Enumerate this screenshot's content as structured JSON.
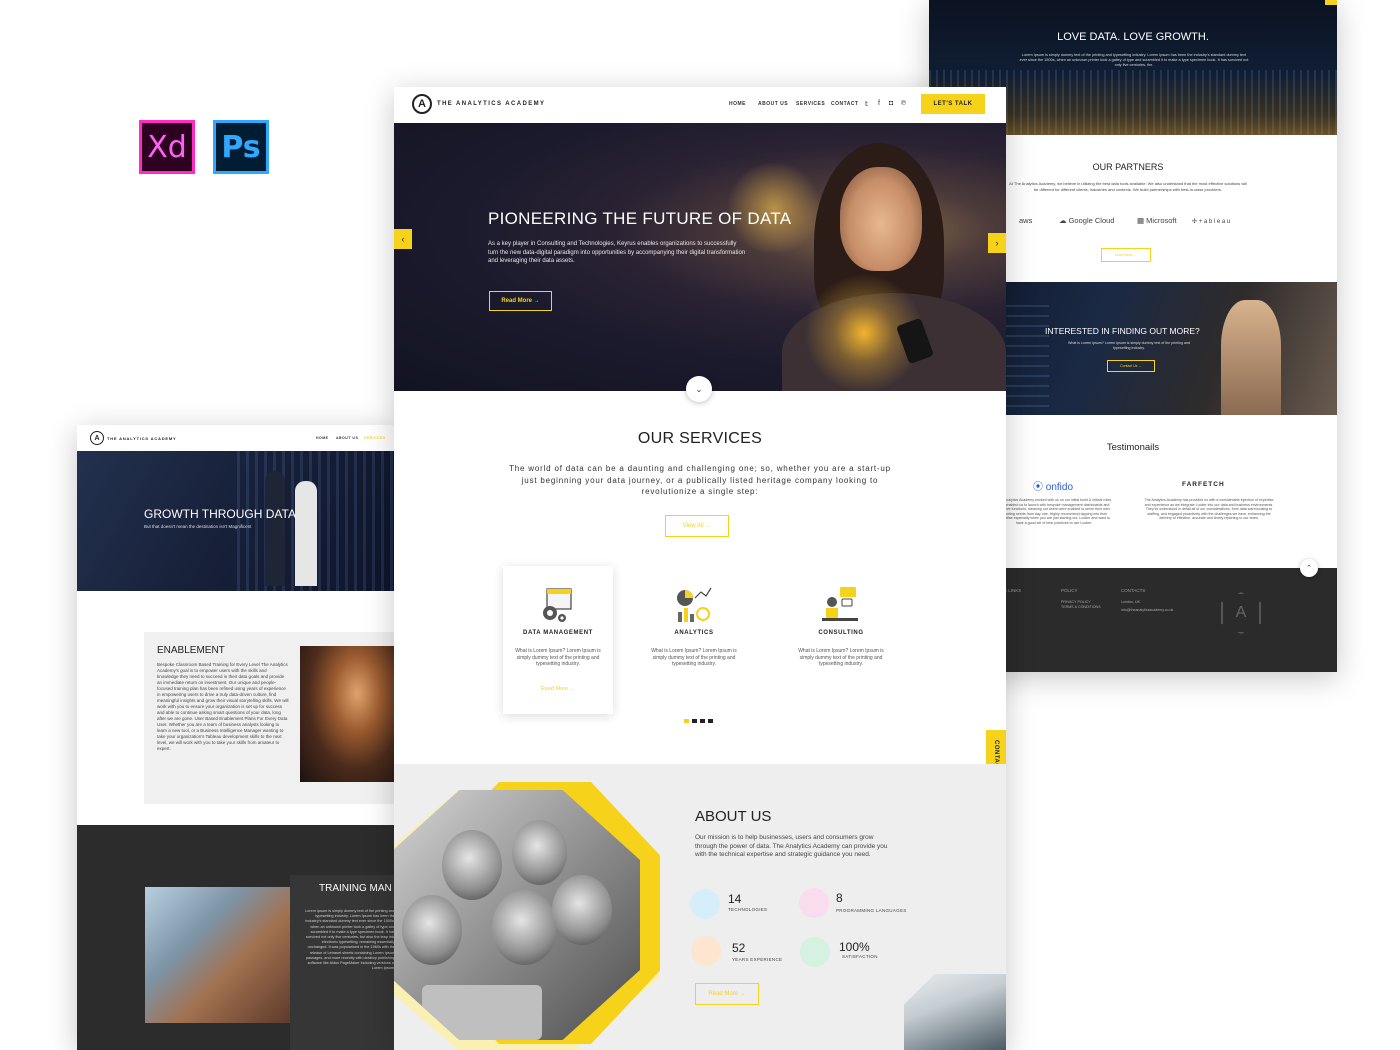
{
  "badges": {
    "xd": "Xd",
    "ps": "Ps"
  },
  "main": {
    "logo_letter": "A",
    "logo_text": "The Analytics Academy",
    "nav": [
      "HOME",
      "ABOUT US",
      "SERVICES",
      "CONTACT"
    ],
    "social_icons": [
      "twitter-icon",
      "facebook-icon",
      "instagram-icon",
      "pinterest-icon"
    ],
    "cta": "LET'S TALK",
    "hero": {
      "title": "PIONEERING THE FUTURE OF DATA",
      "text": "As a key player in Consulting and Technologies, Keyrus enables organizations to successfully turn the new data-digital paradigm into opportunities by accompanying their digital transformation and leveraging their data assets.",
      "button": "Read More →",
      "prev": "‹",
      "next": "›",
      "down": "⌄"
    },
    "services": {
      "title": "OUR SERVICES",
      "text": "The world of data can be a daunting and challenging one; so, whether you are a start-up just beginning your data journey, or a publically listed heritage company looking to revolutionize a single step:",
      "button": "View All →",
      "items": [
        {
          "title": "DATA MANAGEMENT",
          "desc": "What is Lorem Ipsum? Lorem Ipsum is simply dummy text of the printing and typesetting industry.",
          "more": "Read More →"
        },
        {
          "title": "ANALYTICS",
          "desc": "What is Lorem Ipsum? Lorem Ipsum is simply dummy text of the printing and typesetting industry."
        },
        {
          "title": "CONSULTING",
          "desc": "What is Lorem Ipsum? Lorem Ipsum is simply dummy text of the printing and typesetting industry."
        }
      ]
    },
    "contact_tab": "CONTACT US",
    "about": {
      "title": "ABOUT US",
      "text": "Our mission is to help businesses, users and consumers grow through the power of data. The Analytics Academy can provide you with the technical expertise and strategic guidance you need.",
      "stats": [
        {
          "value": "14",
          "label": "TECHNOLOGIES",
          "color": "#5bb6e6"
        },
        {
          "value": "8",
          "label": "PROGRAMMING LANGUAGES",
          "color": "#e86bb8"
        },
        {
          "value": "52",
          "label": "YEARS EXPERIENCE",
          "color": "#f29a4a"
        },
        {
          "value": "100%",
          "label": "SATISFACTION",
          "color": "#4fbf84"
        }
      ],
      "button": "Read More →"
    }
  },
  "left": {
    "logo_text": "The Analytics Academy",
    "nav": [
      "HOME",
      "ABOUT US",
      "SERVICES"
    ],
    "hero_title": "GROWTH THROUGH DATA",
    "hero_text": "But that doesn't mean the destination isn't Magnificent",
    "enablement_title": "ENABLEMENT",
    "enablement_text": "Bespoke Classroom Based Training for Every Level The Analytics Academy's goal is to empower users with the skills and knowledge they need to succeed in their data goals and provide an immediate return on investment. Our unique and people-focused training plan has been refined using years of experience in empowering users to drive a truly data-driven culture, find meaningful insights and grow their visual storytelling skills. We will work with you to ensure your organization is set up for success and able to continue asking smart questions of your data, long after we are gone. User Based Enablement Plans For Every Data User. Whether you are a team of business analysts looking to learn a new tool, or a Business Intelligence Manager wanting to take your organization's Tableau development skills to the next level, we will work with you to take your skills from amateur to expert.",
    "training_title": "TRAINING MAN",
    "training_text": "Lorem Ipsum is simply dummy text of the printing and typesetting industry. Lorem Ipsum has been the industry's standard dummy text ever since the 1500s, when an unknown printer took a galley of type and scrambled it to make a type specimen book. It has survived not only five centuries, but also the leap into electronic typesetting, remaining essentially unchanged. It was popularised in the 1960s with the release of Letraset sheets containing Lorem Ipsum passages, and more recently with desktop publishing software like Aldus PageMaker including versions of Lorem Ipsum."
  },
  "right": {
    "top_title": "LOVE DATA. LOVE GROWTH.",
    "top_text": "Lorem Ipsum is simply dummy text of the printing and typesetting industry. Lorem Ipsum has been the industry's standard dummy text ever since the 1500s, when an unknown printer took a galley of type and scrambled it to make a type specimen book. It has survived not only five centuries, the.",
    "partners_title": "OUR PARTNERS",
    "partners_text": "At The Analytics Academy, we believe in utilizing the best data tools available. We also understand that the most effective solutions will be different for different clients, industries and contexts. We build partnerships with best-in-class providers.",
    "partners": [
      "aws",
      "Google Cloud",
      "Microsoft",
      "+ a b l e a u"
    ],
    "partners_button": "Learn More →",
    "interest_title": "INTERESTED IN FINDING OUT MORE?",
    "interest_text": "What is Lorem Ipsum? Lorem Ipsum is simply dummy text of the printing and typesetting industry.",
    "interest_button": "Contact Us →",
    "testimonials_title": "Testimonails",
    "testimonials": [
      {
        "brand": "onfido",
        "quote": "The Analytics Academy worked with us on our initial build & critical roles and enabled us to launch with bespoke management dashboards and intuitive functions, meaning our users were enabled to serve their own reporting needs from day one. Highly recommend tapping into their expertise especially when you are just starting out. Looker and want to have a good set of best practices to use Looker."
      },
      {
        "brand": "FARFETCH",
        "quote": "The Analytics Academy has provided us with a considerable injection of expertise and experience as we integrate Looker into our data and business environments. They've understood in detail all of our considerations, from data warehousing to staffing, and engaged proactively with the challenges we have, enhancing the delivery of effective, accurate and timely reporting to our team."
      }
    ],
    "footer": {
      "links_heading": "K LINKS",
      "policy_heading": "POLICY",
      "policy_items": [
        "PRIVACY POLICY",
        "TERMS & CONDITIONS"
      ],
      "contacts_heading": "CONTACTS",
      "contacts_items": [
        "London, UK",
        "info@theanalyticsacademy.co.uk"
      ]
    },
    "up": "⌃"
  }
}
